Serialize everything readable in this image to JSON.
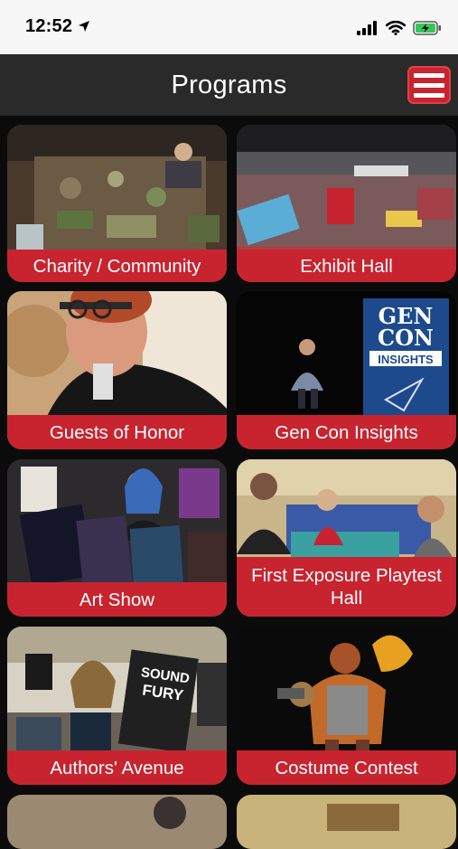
{
  "status_bar": {
    "time": "12:52"
  },
  "header": {
    "title": "Programs"
  },
  "tiles": [
    {
      "label": "Charity / Community",
      "icon": "photo-crowd-gaming"
    },
    {
      "label": "Exhibit Hall",
      "icon": "photo-exhibit-hall"
    },
    {
      "label": "Guests of Honor",
      "icon": "photo-guest-portrait"
    },
    {
      "label": "Gen Con Insights",
      "icon": "photo-speaker-stage"
    },
    {
      "label": "Art Show",
      "icon": "photo-art-show"
    },
    {
      "label": "First Exposure Playtest Hall",
      "icon": "photo-playtest-hall"
    },
    {
      "label": "Authors' Avenue",
      "icon": "photo-books-table"
    },
    {
      "label": "Costume Contest",
      "icon": "photo-costume"
    }
  ],
  "banner": {
    "line1": "GEN",
    "line2": "CON",
    "line3": "INSIGHTS"
  },
  "book": {
    "line1": "SOUND",
    "line2": "FURY"
  },
  "colors": {
    "accent": "#c8242f",
    "nav": "#2a2a2a",
    "background": "#0b0b0b"
  }
}
